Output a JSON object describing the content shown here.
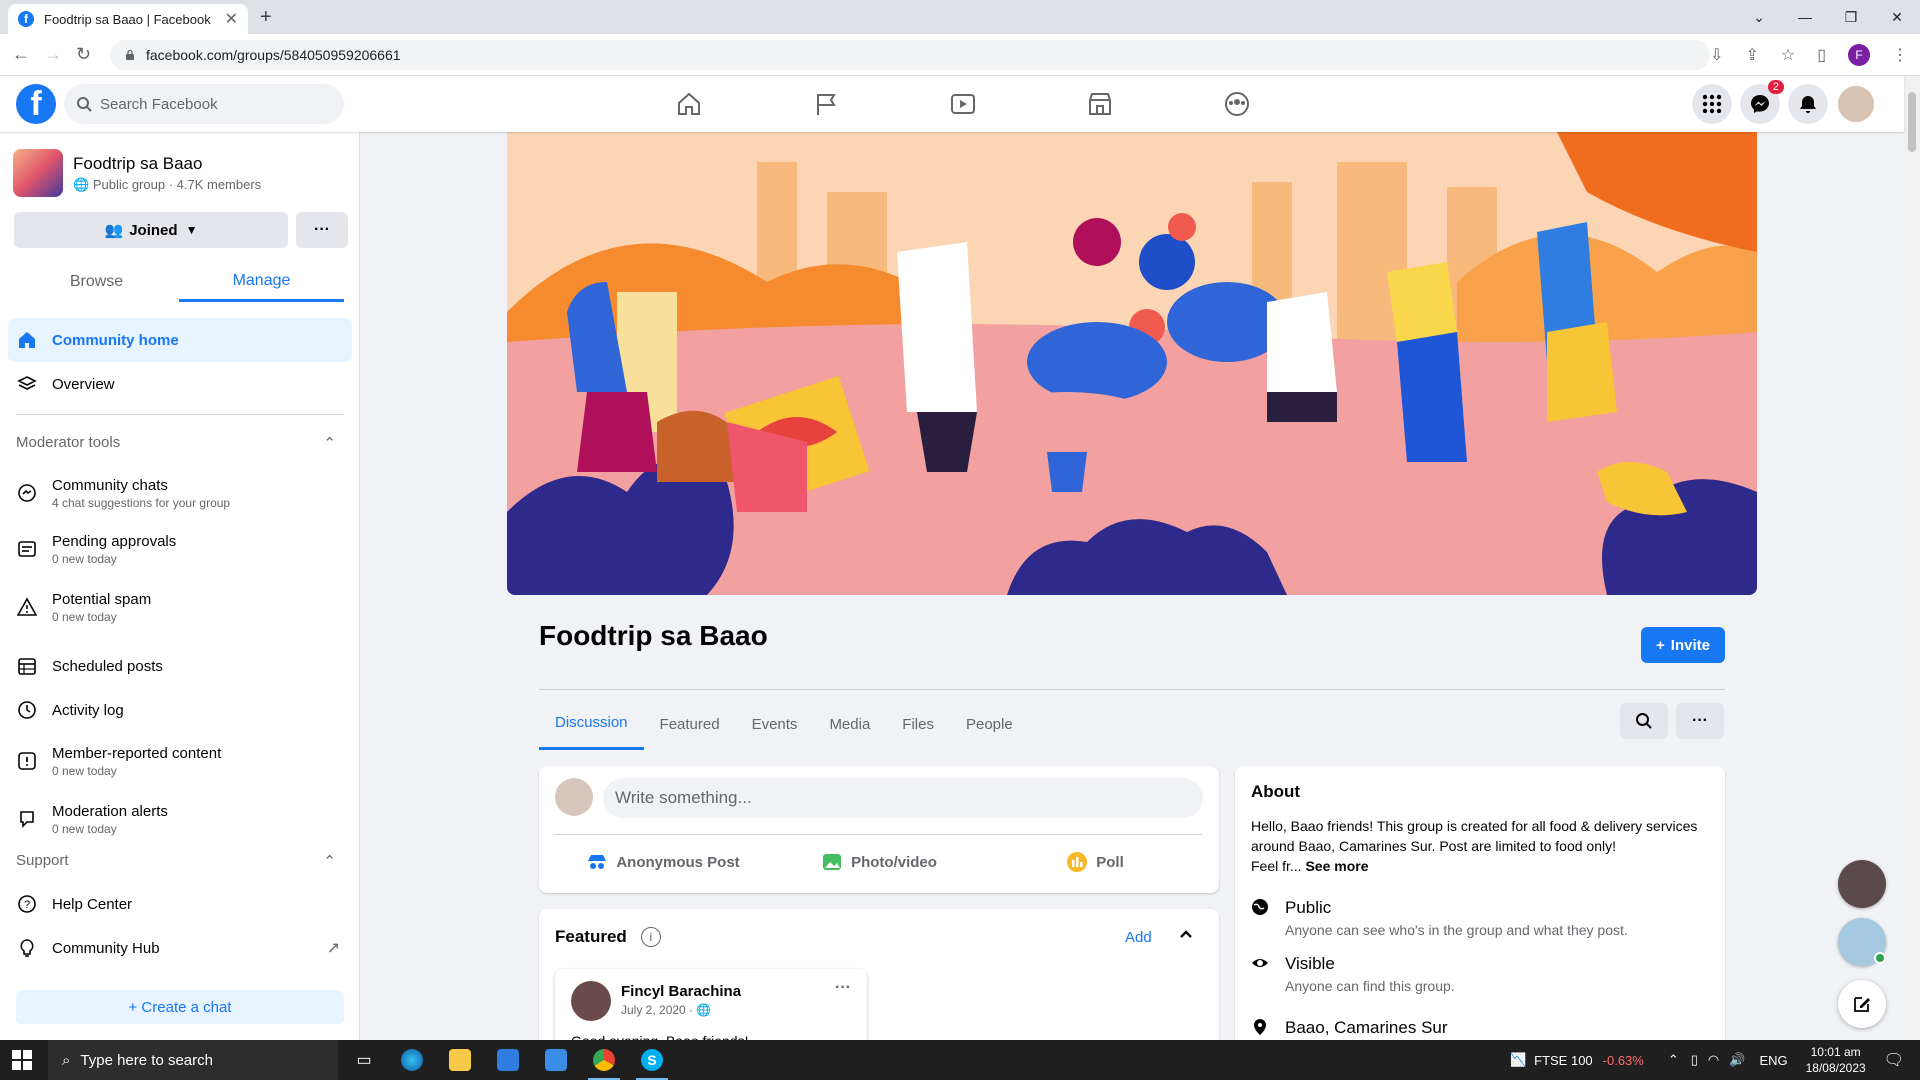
{
  "browser": {
    "tab_title": "Foodtrip sa Baao | Facebook",
    "url": "facebook.com/groups/584050959206661"
  },
  "fb": {
    "search_placeholder": "Search Facebook",
    "messenger_badge": "2"
  },
  "sidebar": {
    "group_name": "Foodtrip sa Baao",
    "group_meta": "Public group · 4.7K members",
    "joined_label": "Joined",
    "tabs": [
      "Browse",
      "Manage"
    ],
    "nav": [
      {
        "label": "Community home"
      },
      {
        "label": "Overview"
      }
    ],
    "moderator_heading": "Moderator tools",
    "moderator": [
      {
        "label": "Community chats",
        "sub": "4 chat suggestions for your group"
      },
      {
        "label": "Pending approvals",
        "sub": "0 new today"
      },
      {
        "label": "Potential spam",
        "sub": "0 new today"
      },
      {
        "label": "Scheduled posts",
        "sub": ""
      },
      {
        "label": "Activity log",
        "sub": ""
      },
      {
        "label": "Member-reported content",
        "sub": "0 new today"
      },
      {
        "label": "Moderation alerts",
        "sub": "0 new today"
      }
    ],
    "support_heading": "Support",
    "support": [
      {
        "label": "Help Center"
      },
      {
        "label": "Community Hub"
      }
    ],
    "create_chat": "+ Create a chat"
  },
  "group": {
    "title": "Foodtrip sa Baao",
    "invite_label": "Invite",
    "tabs": [
      "Discussion",
      "Featured",
      "Events",
      "Media",
      "Files",
      "People"
    ]
  },
  "composer": {
    "placeholder": "Write something...",
    "actions": [
      "Anonymous Post",
      "Photo/video",
      "Poll"
    ]
  },
  "featured": {
    "heading": "Featured",
    "add_label": "Add",
    "post": {
      "author": "Fincyl Barachina",
      "date": "July 2, 2020 · ",
      "text": "Good evening, Baao friends!"
    }
  },
  "about": {
    "heading": "About",
    "text": "Hello, Baao friends! This group is created for all food & delivery services around Baao, Camarines Sur. Post are limited to food only!",
    "truncated": "Feel fr... ",
    "see_more": "See more",
    "rows": [
      {
        "title": "Public",
        "sub": "Anyone can see who's in the group and what they post."
      },
      {
        "title": "Visible",
        "sub": "Anyone can find this group."
      },
      {
        "title": "Baao, Camarines Sur",
        "sub": ""
      }
    ]
  },
  "taskbar": {
    "search_placeholder": "Type here to search",
    "ticker_name": "FTSE 100",
    "ticker_change": "-0.63%",
    "lang": "ENG",
    "time": "10:01 am",
    "date": "18/08/2023"
  },
  "colors": {
    "fb_blue": "#1877f2",
    "active_bg": "#e7f3ff",
    "ticker_down": "#ff6b6b"
  }
}
